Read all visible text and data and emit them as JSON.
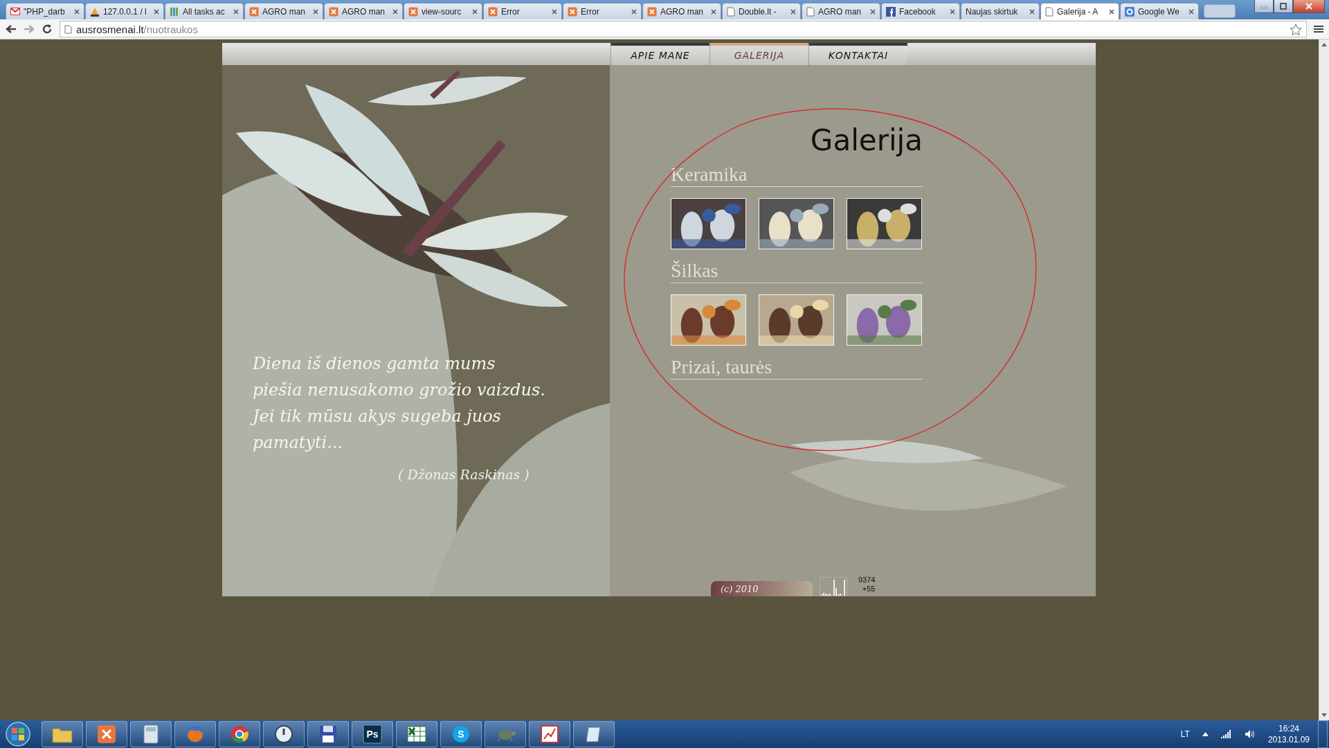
{
  "browser": {
    "tabs": [
      {
        "title": "\"PHP_darb",
        "kind": "gmail",
        "selected": false
      },
      {
        "title": "127.0.0.1 / l",
        "kind": "pma",
        "selected": false
      },
      {
        "title": "All tasks ac",
        "kind": "tasks",
        "selected": false
      },
      {
        "title": "AGRO man",
        "kind": "xampp",
        "selected": false
      },
      {
        "title": "AGRO man",
        "kind": "xampp",
        "selected": false
      },
      {
        "title": "view-sourc",
        "kind": "xampp",
        "selected": false
      },
      {
        "title": "Error",
        "kind": "xampp",
        "selected": false
      },
      {
        "title": "Error",
        "kind": "xampp",
        "selected": false
      },
      {
        "title": "AGRO man",
        "kind": "xampp",
        "selected": false
      },
      {
        "title": "Double.lt -",
        "kind": "page",
        "selected": false
      },
      {
        "title": "AGRO man",
        "kind": "page",
        "selected": false
      },
      {
        "title": "Facebook",
        "kind": "facebook",
        "selected": false
      },
      {
        "title": "Naujas skirtuk",
        "kind": "blank",
        "selected": false
      },
      {
        "title": "Galerija - A",
        "kind": "page",
        "selected": true
      },
      {
        "title": "Google We",
        "kind": "google",
        "selected": false
      }
    ]
  },
  "address_bar": {
    "host": "ausrosmenai.lt",
    "path": "/nuotraukos"
  },
  "site": {
    "nav": [
      {
        "label": "APIE MANE",
        "selected": false
      },
      {
        "label": "GALERIJA",
        "selected": true
      },
      {
        "label": "KONTAKTAI",
        "selected": false
      }
    ],
    "quote": {
      "lines": [
        "Diena iš dienos gamta mums",
        "piešia nenusakomo grožio vaizdus.",
        "Jei tik mūsu akys sugeba juos",
        "pamatyti..."
      ],
      "author": "( Džonas Raskinas )"
    },
    "gallery": {
      "title": "Galerija",
      "sections": [
        {
          "heading": "Keramika"
        },
        {
          "heading": "Šilkas"
        },
        {
          "heading": "Prizai, taurės"
        }
      ]
    },
    "footer": {
      "copyright": "(c) 2010",
      "counter_total": "9374",
      "counter_today": "+55"
    }
  },
  "taskbar": {
    "apps": [
      {
        "kind": "folder"
      },
      {
        "kind": "xampp"
      },
      {
        "kind": "calculator"
      },
      {
        "kind": "firefox"
      },
      {
        "kind": "chrome"
      },
      {
        "kind": "clock"
      },
      {
        "kind": "floppy"
      },
      {
        "kind": "photoshop",
        "label": "Ps"
      },
      {
        "kind": "excel"
      },
      {
        "kind": "skype",
        "label": "S"
      },
      {
        "kind": "turtle"
      },
      {
        "kind": "chart"
      },
      {
        "kind": "notepad"
      }
    ],
    "tray": {
      "language": "LT",
      "time": "16:24",
      "date": "2013.01.09"
    }
  }
}
